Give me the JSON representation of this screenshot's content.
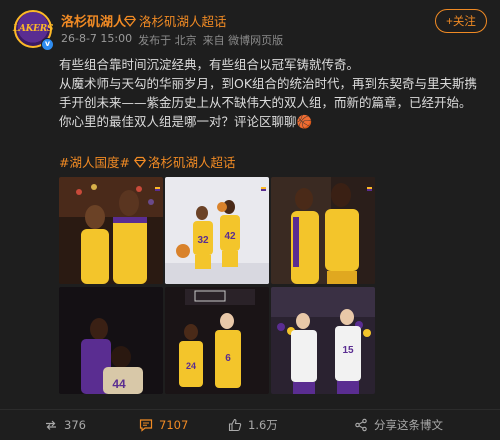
{
  "post": {
    "username": "洛杉矶湖人",
    "super_topic": "洛杉矶湖人超话",
    "date": "26-8-7 15:00",
    "publish_label": "发布于 北京",
    "source_label": "来自 微博网页版",
    "follow_label": "+关注",
    "verified_mark": "v",
    "avatar_text": "LAKERS",
    "paragraphs": [
      "有些组合靠时间沉淀经典，有些组合以冠军铸就传奇。",
      "从魔术师与天勾的华丽岁月，到OK组合的统治时代，再到东契奇与里夫斯携手开创未来——紫金历史上从不缺伟大的双人组，而新的篇章，已经开始。",
      "你心里的最佳双人组是哪一对？评论区聊聊🏀"
    ],
    "hashtag": "#湖人国度#",
    "hashtag_super": "洛杉矶湖人超话"
  },
  "photos": [
    {
      "name": "photo-magic-kareem"
    },
    {
      "name": "photo-jerseys-32-42"
    },
    {
      "name": "photo-shaq-kobe-yellow"
    },
    {
      "name": "photo-kareem-44"
    },
    {
      "name": "photo-24-6"
    },
    {
      "name": "photo-doncic-reaves"
    }
  ],
  "jerseys": {
    "p2a": "32",
    "p2b": "42",
    "p4": "44",
    "p5a": "24",
    "p5b": "6",
    "p6b": "15"
  },
  "actions": {
    "share_count": "376",
    "comment_count": "7107",
    "like_count": "1.6万",
    "share_post_label": "分享这条博文"
  },
  "colors": {
    "accent": "#f08a24",
    "lakers_purple": "#5a2d91",
    "lakers_gold": "#fdb927"
  }
}
